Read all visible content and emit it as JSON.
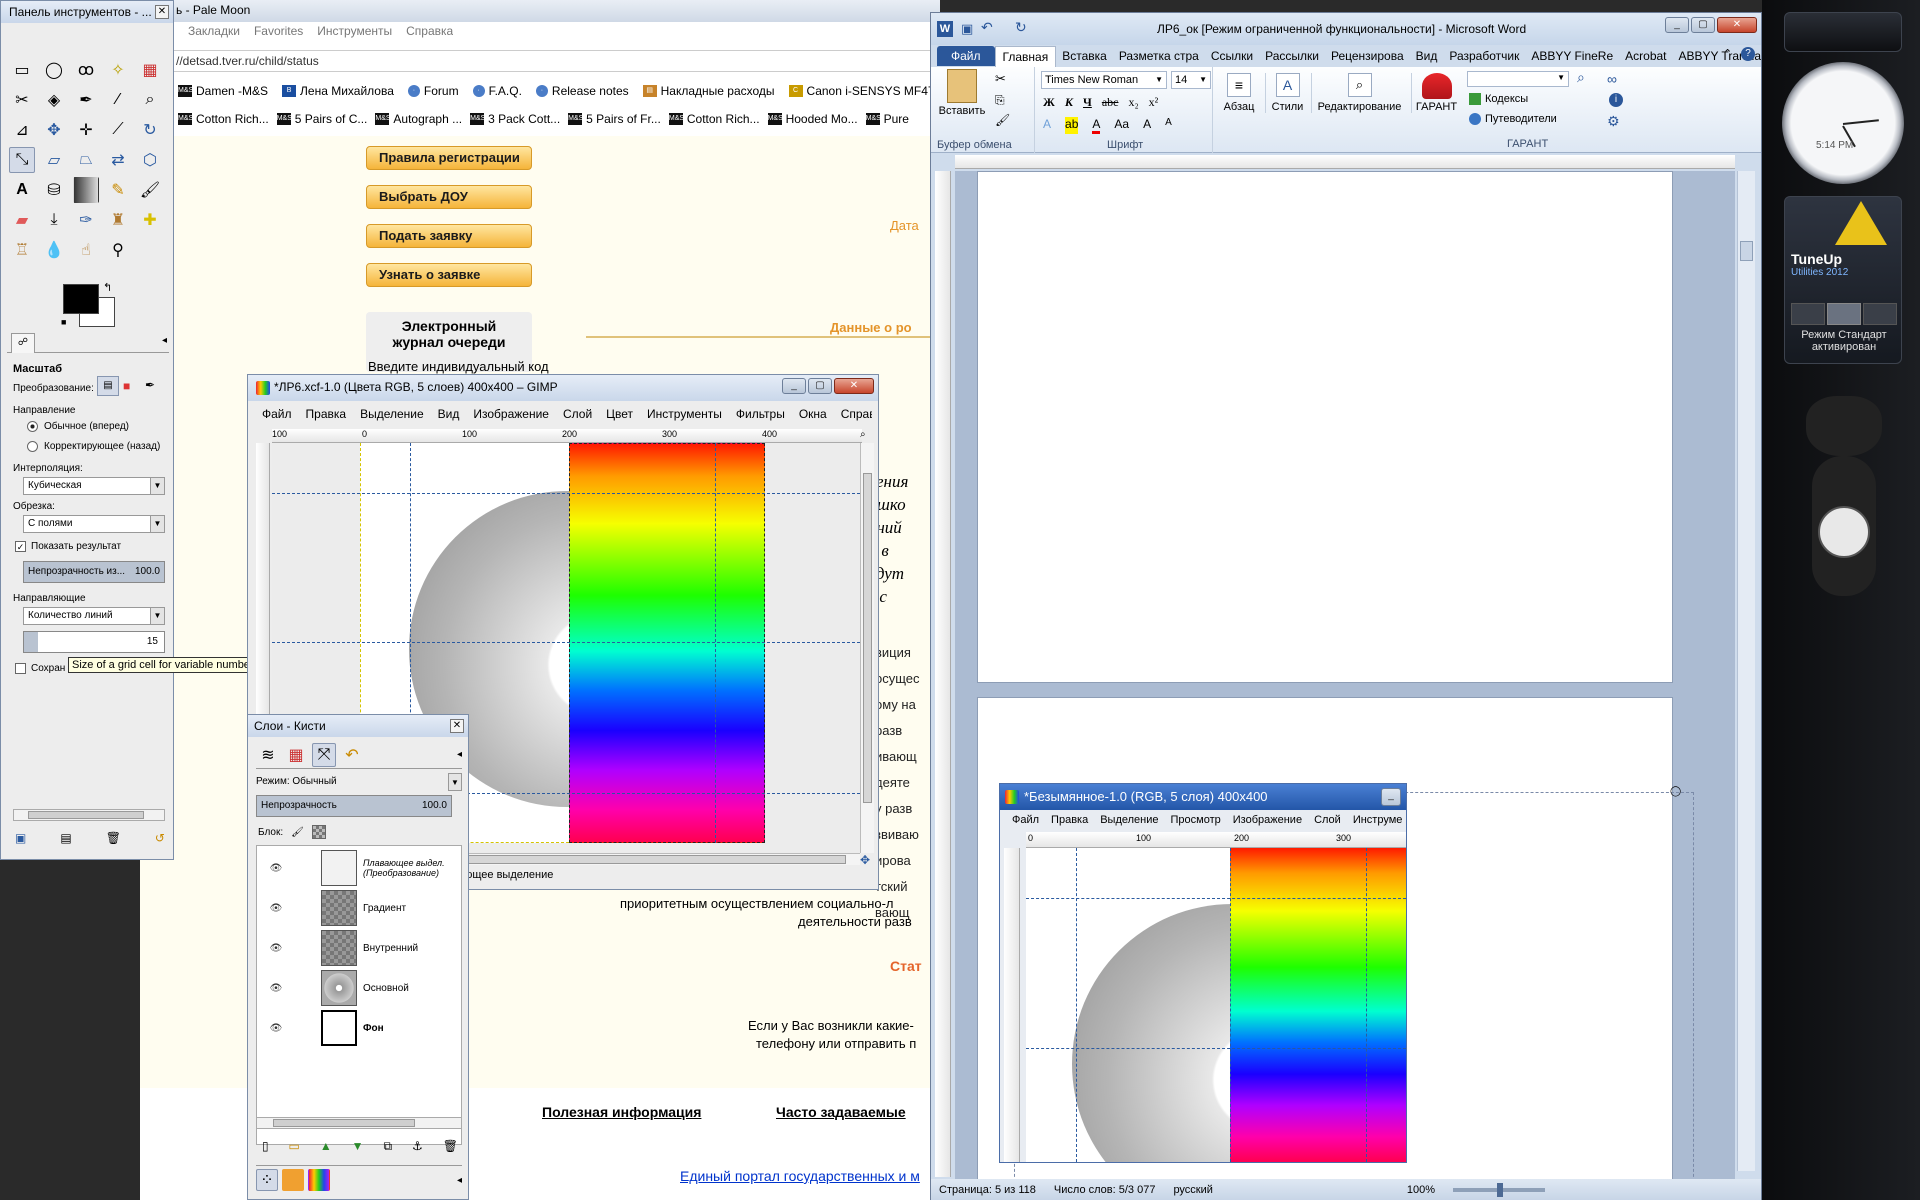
{
  "colors": {
    "desktop": "#1d1d1d",
    "sidebar": "#0f1012",
    "accent": "#2b579a",
    "gimp_bg": "#ededed"
  },
  "browser": {
    "title": "ь - Pale Moon",
    "menu": [
      "Закладки",
      "Favorites",
      "Инструменты",
      "Справка"
    ],
    "url": "//detsad.tver.ru/child/status",
    "bookmarks": [
      "Damen -M&S",
      "Лена Михайлова",
      "Forum",
      "F.A.Q.",
      "Release notes",
      "Накладные расходы",
      "Canon i-SENSYS MF47..."
    ],
    "tabs": [
      "Cotton Rich...",
      "5 Pairs of C...",
      "Autograph ...",
      "3 Pack Cott...",
      "5 Pairs of Fr...",
      "Cotton Rich...",
      "Hooded Mo...",
      "Pure"
    ],
    "buttons": [
      "Правила регистрации",
      "Выбрать ДОУ",
      "Подать заявку",
      "Узнать о заявке"
    ],
    "journal_title": "Электронный журнал очереди",
    "journal_text": "Введите индивидуальный код",
    "date_label": "Дата",
    "data_label": "Данные о ро",
    "italic_lines": [
      "енения",
      "рошко",
      "дений",
      "да в",
      "будут",
      "за с"
    ],
    "text_lines": [
      "виция",
      "осущес",
      "ому на",
      "разв",
      "ивающ",
      "деяте",
      "у разв",
      "звиваю",
      "ирова",
      "тский",
      "вающ"
    ],
    "full_line1": "приоритетным осуществлением социально-л",
    "full_line2": "деятельности разв",
    "status_label": "Стат",
    "contact1": "Если у Вас возникли какие-",
    "contact2": "телефону или отправить п",
    "footer_links": [
      "Полезная информация",
      "Часто задаваемые"
    ],
    "portal_link": "Единый портал государственных и м"
  },
  "toolbox": {
    "title": "Панель инструментов - ...",
    "tool_name": "Масштаб",
    "transform_label": "Преобразование:",
    "direction_label": "Направление",
    "direction_options": [
      "Обычное (вперед)",
      "Корректирующее (назад)"
    ],
    "interpolation_label": "Интерполяция:",
    "interpolation_value": "Кубическая",
    "clipping_label": "Обрезка:",
    "clipping_value": "С полями",
    "show_result": "Показать результат",
    "opacity_label": "Непрозрачность из...",
    "opacity_value": "100.0",
    "guides_label": "Направляющие",
    "guides_value": "Количество линий",
    "grid_value": "15",
    "keep_label": "Сохран",
    "tooltip": "Size of a grid cell for variable number of composition guides"
  },
  "gimp_main": {
    "title": "*ЛР6.xcf-1.0 (Цвета RGB, 5 слоев) 400x400 – GIMP",
    "menu": [
      "Файл",
      "Правка",
      "Выделение",
      "Вид",
      "Изображение",
      "Слой",
      "Цвет",
      "Инструменты",
      "Фильтры",
      "Окна",
      "Справк"
    ],
    "ruler": [
      "100",
      "0",
      "100",
      "200",
      "300",
      "400"
    ],
    "status": "ающее выделение"
  },
  "layers": {
    "title": "Слои - Кисти",
    "mode_label": "Режим: Обычный",
    "opacity_label": "Непрозрачность",
    "opacity_value": "100.0",
    "lock_label": "Блок:",
    "items": [
      {
        "name": "Плавающее выдел. (Преобразование)"
      },
      {
        "name": "Градиент"
      },
      {
        "name": "Внутренний"
      },
      {
        "name": "Основной"
      },
      {
        "name": "Фон"
      }
    ]
  },
  "word": {
    "title": "ЛР6_ок [Режим ограниченной функциональности] - Microsoft Word",
    "tabs": [
      "Файл",
      "Главная",
      "Вставка",
      "Разметка стра",
      "Ссылки",
      "Рассылки",
      "Рецензирова",
      "Вид",
      "Разработчик",
      "ABBYY FineRe",
      "Acrobat",
      "ABBYY Translat"
    ],
    "paste": "Вставить",
    "clipboard": "Буфер обмена",
    "font": "Times New Roman",
    "size": "14",
    "font_group": "Шрифт",
    "paragraph": "Абзац",
    "styles": "Стили",
    "editing": "Редактирование",
    "garant_btn": "ГАРАНТ",
    "codex": "Кодексы",
    "guides": "Путеводители",
    "garant_group": "ГАРАНТ",
    "status_page": "Страница: 5 из 118",
    "status_words": "Число слов: 5/3 077",
    "status_lang": "русский",
    "zoom": "100%"
  },
  "gimp_embedded": {
    "title": "*Безымянное-1.0 (RGB, 5 слоя) 400x400",
    "menu": [
      "Файл",
      "Правка",
      "Выделение",
      "Просмотр",
      "Изображение",
      "Слой",
      "Инструме"
    ],
    "ruler": [
      "0",
      "100",
      "200",
      "300"
    ]
  },
  "gadgets": {
    "clock_time": "5:14 PM",
    "tuneup_title": "TuneUp",
    "tuneup_sub": "Utilities 2012",
    "tuneup_mode": "Режим Стандарт активирован"
  }
}
